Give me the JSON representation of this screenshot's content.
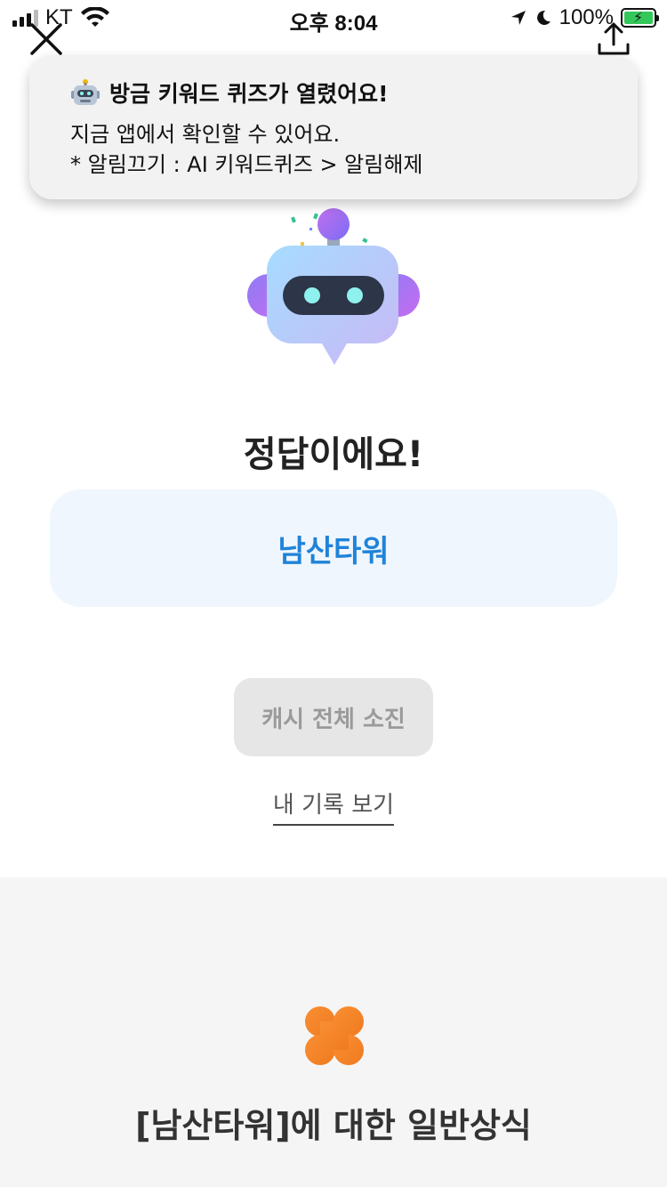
{
  "status_bar": {
    "carrier": "KT",
    "time": "오후 8:04",
    "battery": "100%"
  },
  "notification": {
    "title": "방금 키워드 퀴즈가 열렸어요!",
    "line1": "지금 앱에서 확인할 수 있어요.",
    "line2": "* 알림끄기 : AI 키워드퀴즈 > 알림해제"
  },
  "result": {
    "title": "정답이에요!",
    "answer": "남산타워"
  },
  "actions": {
    "cash_button": "캐시 전체 소진",
    "history_link": "내 기록 보기"
  },
  "trivia": {
    "title": "[남산타워]에 대한 일반상식"
  },
  "icons": {
    "close": "close-icon",
    "share": "share-icon",
    "robot": "robot-illustration",
    "clover": "clover-icon"
  },
  "colors": {
    "answer_text": "#1f83d9",
    "answer_bg": "#eff6fd",
    "clover": "#f58a2b",
    "section_bg": "#f5f5f5"
  }
}
